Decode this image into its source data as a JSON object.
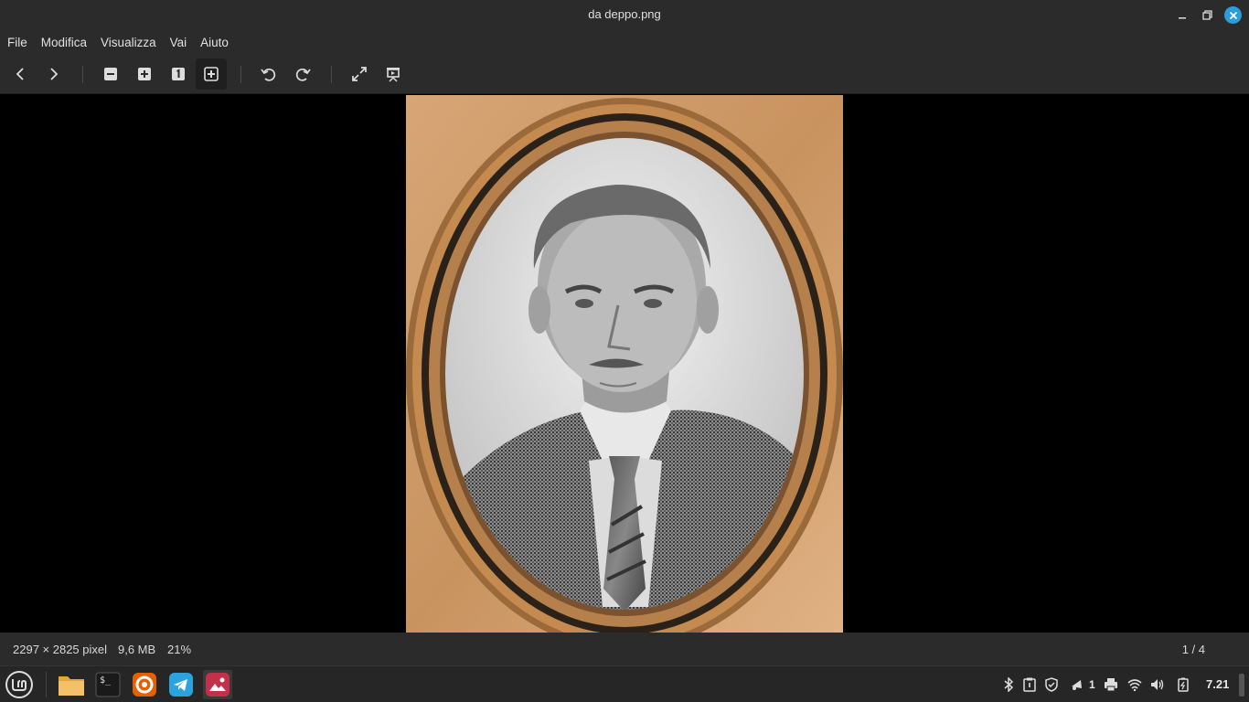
{
  "window": {
    "title": "da deppo.png"
  },
  "menu": {
    "items": [
      "File",
      "Modifica",
      "Visualizza",
      "Vai",
      "Aiuto"
    ]
  },
  "toolbar": {
    "buttons": [
      "previous-icon",
      "next-icon",
      "zoom-out-icon",
      "zoom-in-icon",
      "zoom-1to1-icon",
      "best-fit-icon",
      "rotate-left-icon",
      "rotate-right-icon",
      "fullscreen-icon",
      "slideshow-icon"
    ],
    "active": "best-fit-icon"
  },
  "image": {
    "description_icon": "portrait-photo"
  },
  "status": {
    "dimensions": "2297 × 2825 pixel",
    "filesize": "9,6 MB",
    "zoom": "21%",
    "page": "1 / 4"
  },
  "taskbar": {
    "apps": [
      "mint-menu-icon",
      "files-icon",
      "terminal-icon",
      "firefox-icon",
      "telegram-icon",
      "image-viewer-icon"
    ],
    "tray": [
      "bluetooth-icon",
      "clipboard-icon",
      "shield-icon",
      "notifications-icon",
      "printer-icon",
      "wifi-icon",
      "volume-icon",
      "battery-icon"
    ],
    "notifications_count": "1",
    "clock": "7.21"
  },
  "colors": {
    "accent": "#2d9cdb",
    "chrome": "#2b2b2b"
  }
}
